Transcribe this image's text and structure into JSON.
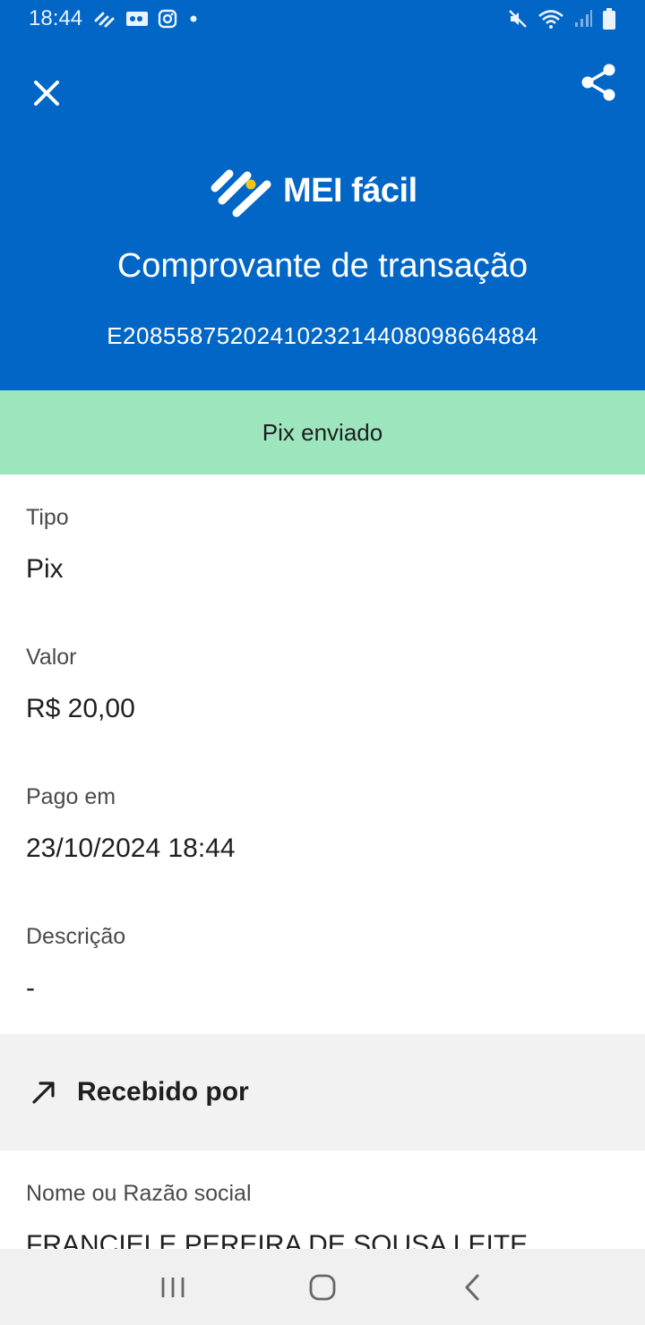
{
  "status_bar": {
    "time": "18:44",
    "left_icons": [
      "link-icon",
      "voicemail-icon",
      "instagram-icon",
      "dot-icon"
    ],
    "right_icons": [
      "mute-icon",
      "wifi-icon",
      "signal-icon",
      "battery-icon"
    ]
  },
  "app_bar": {
    "close_icon": "close-icon",
    "share_icon": "share-icon"
  },
  "header": {
    "brand": "MEI fácil",
    "title": "Comprovante de transação",
    "transaction_id": "E20855875202410232144080986648​84"
  },
  "status_band": {
    "text": "Pix enviado",
    "color": "#9de5bd"
  },
  "details": [
    {
      "label": "Tipo",
      "value": "Pix"
    },
    {
      "label": "Valor",
      "value": "R$ 20,00"
    },
    {
      "label": "Pago em",
      "value": "23/10/2024 18:44"
    },
    {
      "label": "Descrição",
      "value": "-"
    }
  ],
  "receiver_section": {
    "title": "Recebido por",
    "icon": "arrow-up-right-icon",
    "fields": [
      {
        "label": "Nome ou Razão social",
        "value": "FRANCIELE PEREIRA DE SOUSA LEITE"
      }
    ]
  },
  "nav_bar": {
    "buttons": [
      "recents-icon",
      "home-icon",
      "back-icon"
    ]
  },
  "colors": {
    "primary": "#0166c6",
    "success_band": "#9de5bd",
    "section_bg": "#f2f2f2",
    "logo_accent": "#f5c518"
  }
}
